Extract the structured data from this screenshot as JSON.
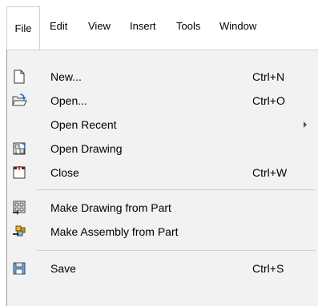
{
  "menubar": {
    "items": [
      {
        "label": "File"
      },
      {
        "label": "Edit"
      },
      {
        "label": "View"
      },
      {
        "label": "Insert"
      },
      {
        "label": "Tools"
      },
      {
        "label": "Window"
      }
    ]
  },
  "file_menu": {
    "items": [
      {
        "label": "New...",
        "shortcut": "Ctrl+N",
        "icon": "new-document-icon"
      },
      {
        "label": "Open...",
        "shortcut": "Ctrl+O",
        "icon": "open-folder-icon"
      },
      {
        "label": "Open Recent",
        "shortcut": "",
        "icon": "",
        "submenu": true
      },
      {
        "label": "Open Drawing",
        "shortcut": "",
        "icon": "open-drawing-icon"
      },
      {
        "label": "Close",
        "shortcut": "Ctrl+W",
        "icon": "close-document-icon"
      },
      {
        "label": "Make Drawing from Part",
        "shortcut": "",
        "icon": "make-drawing-icon"
      },
      {
        "label": "Make Assembly from Part",
        "shortcut": "",
        "icon": "make-assembly-icon"
      },
      {
        "label": "Save",
        "shortcut": "Ctrl+S",
        "icon": "save-icon"
      }
    ]
  }
}
